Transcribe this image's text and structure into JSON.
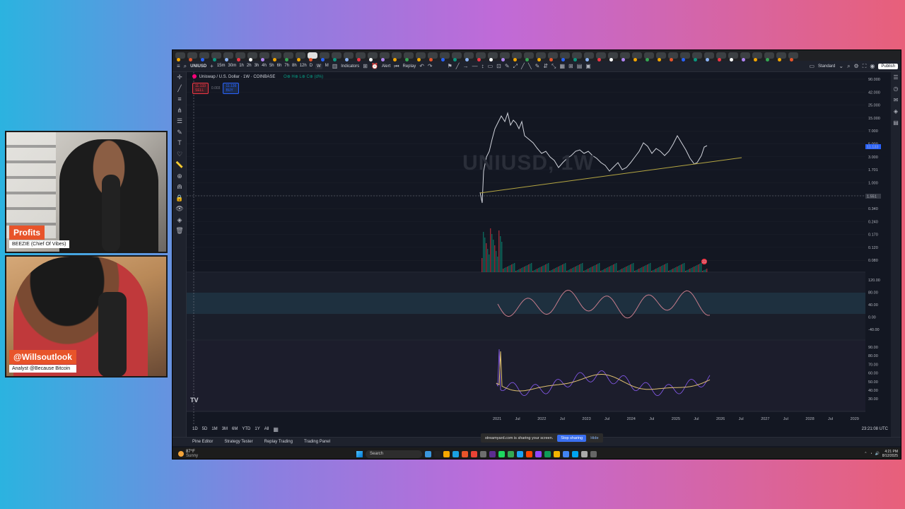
{
  "cams": {
    "cam1": {
      "name": "Profits",
      "subtitle": "BEEZIE (Chief Of Vibes)"
    },
    "cam2": {
      "name": "@Willsoutlook",
      "subtitle": "Analyst @Because Bitcoin"
    }
  },
  "toolbar": {
    "symbol": "UNIUSD",
    "timeframes": [
      "15m",
      "30m",
      "1h",
      "2h",
      "3h",
      "4h",
      "5h",
      "6h",
      "7h",
      "8h",
      "12h",
      "D",
      "W",
      "M"
    ],
    "active_timeframe": "W",
    "indicators_label": "Indicators",
    "alert_label": "Alert",
    "replay_label": "Replay",
    "layout_label": "Standard",
    "publish_label": "Publish"
  },
  "chart": {
    "legend": "Uniswap / U.S. Dollar · 1W · COINBASE",
    "ohlc": "O⊕ H⊕ L⊕ C⊕ (d%)",
    "sell_price": "11.133",
    "sell_label": "SELL",
    "buy_price": "11.136",
    "buy_label": "BUY",
    "spread": "0.003",
    "watermark": "UNIUSD, 1W",
    "price_axis": [
      "90.000",
      "42.000",
      "25.000",
      "15.000",
      "7.000",
      "5.000",
      "3.000",
      "1.701",
      "1.000",
      "0.600",
      "0.340",
      "0.240",
      "0.170",
      "0.120",
      "0.080"
    ],
    "last_price_tag": "11.133",
    "crosshair_price": "1.551",
    "rsi_axis": [
      "120.00",
      "80.00",
      "40.00",
      "0.00",
      "-40.00"
    ],
    "osc_axis": [
      "90.00",
      "80.00",
      "70.00",
      "60.00",
      "50.00",
      "40.00",
      "30.00"
    ],
    "time_axis": [
      "2021",
      "Jul",
      "2022",
      "Jul",
      "2023",
      "Jul",
      "2024",
      "Jul",
      "2025",
      "Jul",
      "2026",
      "Jul",
      "2027",
      "Jul",
      "2028",
      "Jul",
      "2029"
    ],
    "volume_badge": "22",
    "colors": {
      "up": "#089981",
      "down": "#f23645",
      "price_line": "#d1d4dc",
      "trendline": "#b5a642",
      "rsi": "#c77c8b",
      "osc_a": "#8b5cf6",
      "osc_b": "#e0c070"
    }
  },
  "ranges": [
    "1D",
    "5D",
    "1M",
    "3M",
    "6M",
    "YTD",
    "1Y",
    "All"
  ],
  "utc_time": "23:21:08 UTC",
  "panels": [
    "Pine Editor",
    "Strategy Tester",
    "Replay Trading",
    "Trading Panel"
  ],
  "share": {
    "text": "streamyard.com is sharing your screen.",
    "stop": "Stop sharing",
    "hide": "Hide"
  },
  "taskbar": {
    "temp": "87°F",
    "weather": "Sunny",
    "search": "Search",
    "time": "4:21 PM",
    "date": "8/12/2025"
  }
}
